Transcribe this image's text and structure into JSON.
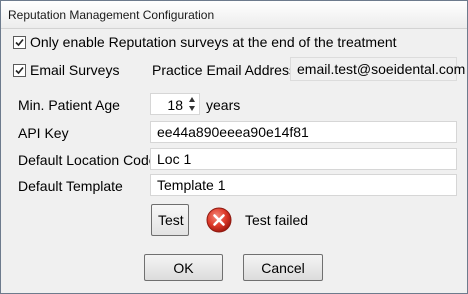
{
  "window": {
    "title": "Reputation Management Configuration"
  },
  "options": {
    "end_of_treatment_label": "Only enable Reputation surveys at the end of the treatment",
    "end_of_treatment_checked": true,
    "email_surveys_label": "Email Surveys",
    "email_surveys_checked": true
  },
  "practice_email": {
    "label": "Practice Email Address",
    "value": "email.test@soeidental.com"
  },
  "min_age": {
    "label": "Min. Patient Age",
    "value": "18",
    "unit": "years"
  },
  "api_key": {
    "label": "API Key",
    "value": "ee44a890eeea90e14f81"
  },
  "location_code": {
    "label": "Default Location Code",
    "value": "Loc 1"
  },
  "template": {
    "label": "Default Template",
    "value": "Template 1"
  },
  "test": {
    "button_label": "Test",
    "status_text": "Test failed",
    "status_color": "#d9241b"
  },
  "dialog_buttons": {
    "ok_label": "OK",
    "cancel_label": "Cancel"
  }
}
